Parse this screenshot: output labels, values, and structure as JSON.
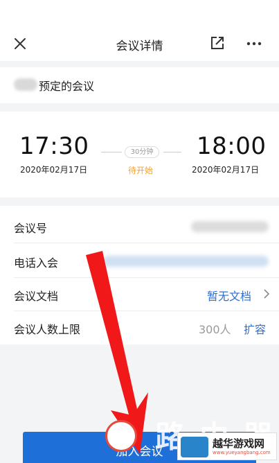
{
  "header": {
    "title": "会议详情",
    "close_icon": "close-icon",
    "share_icon": "open-external-icon",
    "more_icon": "more-icon"
  },
  "organizer": {
    "text": "预定的会议"
  },
  "schedule": {
    "start_time": "17:30",
    "start_date": "2020年02月17日",
    "end_time": "18:00",
    "end_date": "2020年02月17日",
    "duration": "30分钟",
    "status": "待开始",
    "status_color": "#f0a33a"
  },
  "details": {
    "meeting_id_label": "会议号",
    "phone_label": "电话入会",
    "docs_label": "会议文档",
    "docs_value": "暂无文档",
    "capacity_label": "会议人数上限",
    "capacity_value": "300人",
    "expand_label": "扩容"
  },
  "footer": {
    "join_label": "加入会议",
    "accent": "#1e6fd8"
  },
  "watermark": {
    "title": "越华游戏网",
    "url": "www.yueyangbang.com"
  }
}
